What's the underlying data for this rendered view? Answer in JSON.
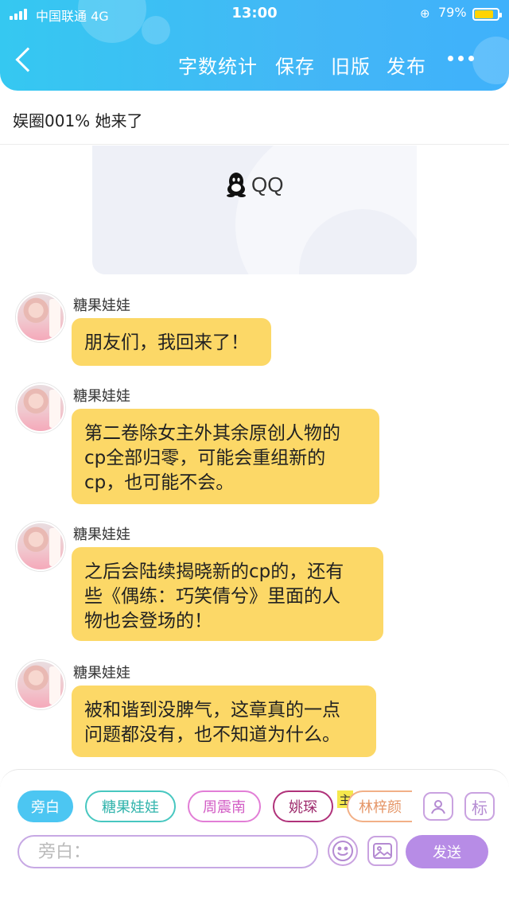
{
  "status_bar": {
    "carrier": "中国联通  4G",
    "time": "13:00",
    "battery": "79%",
    "battery_level": 0.79
  },
  "nav": {
    "word_count": "字数统计",
    "save": "保存",
    "old_version": "旧版",
    "publish": "发布"
  },
  "subtitle": "娱圈001%  她来了",
  "qq_card": {
    "label": "QQ"
  },
  "messages": [
    {
      "author": "糖果娃娃",
      "text": "朋友们，我回来了！"
    },
    {
      "author": "糖果娃娃",
      "line1": "第二卷除女主外其余原创人物的",
      "line2": "cp全部归零，可能会重组新的",
      "line3": "cp，也可能不会。"
    },
    {
      "author": "糖果娃娃",
      "line1": "之后会陆续揭晓新的cp的，还有",
      "line2": "些《偶练：巧笑倩兮》里面的人",
      "line3": "物也会登场的！"
    },
    {
      "author": "糖果娃娃",
      "line1": "被和谐到没脾气，这章真的一点",
      "line2": "问题都没有，也不知道为什么。"
    }
  ],
  "roles": {
    "narration": "旁白",
    "candy": "糖果娃娃",
    "zhou": "周震南",
    "yao": "姚琛",
    "lin": "林梓颜",
    "lead_badge": "主",
    "tag_label": "标"
  },
  "composer": {
    "placeholder": "旁白：",
    "send": "发送"
  },
  "colors": {
    "header": "#43b7f6",
    "bubble": "#fcd867",
    "accent": "#b78ce6"
  }
}
